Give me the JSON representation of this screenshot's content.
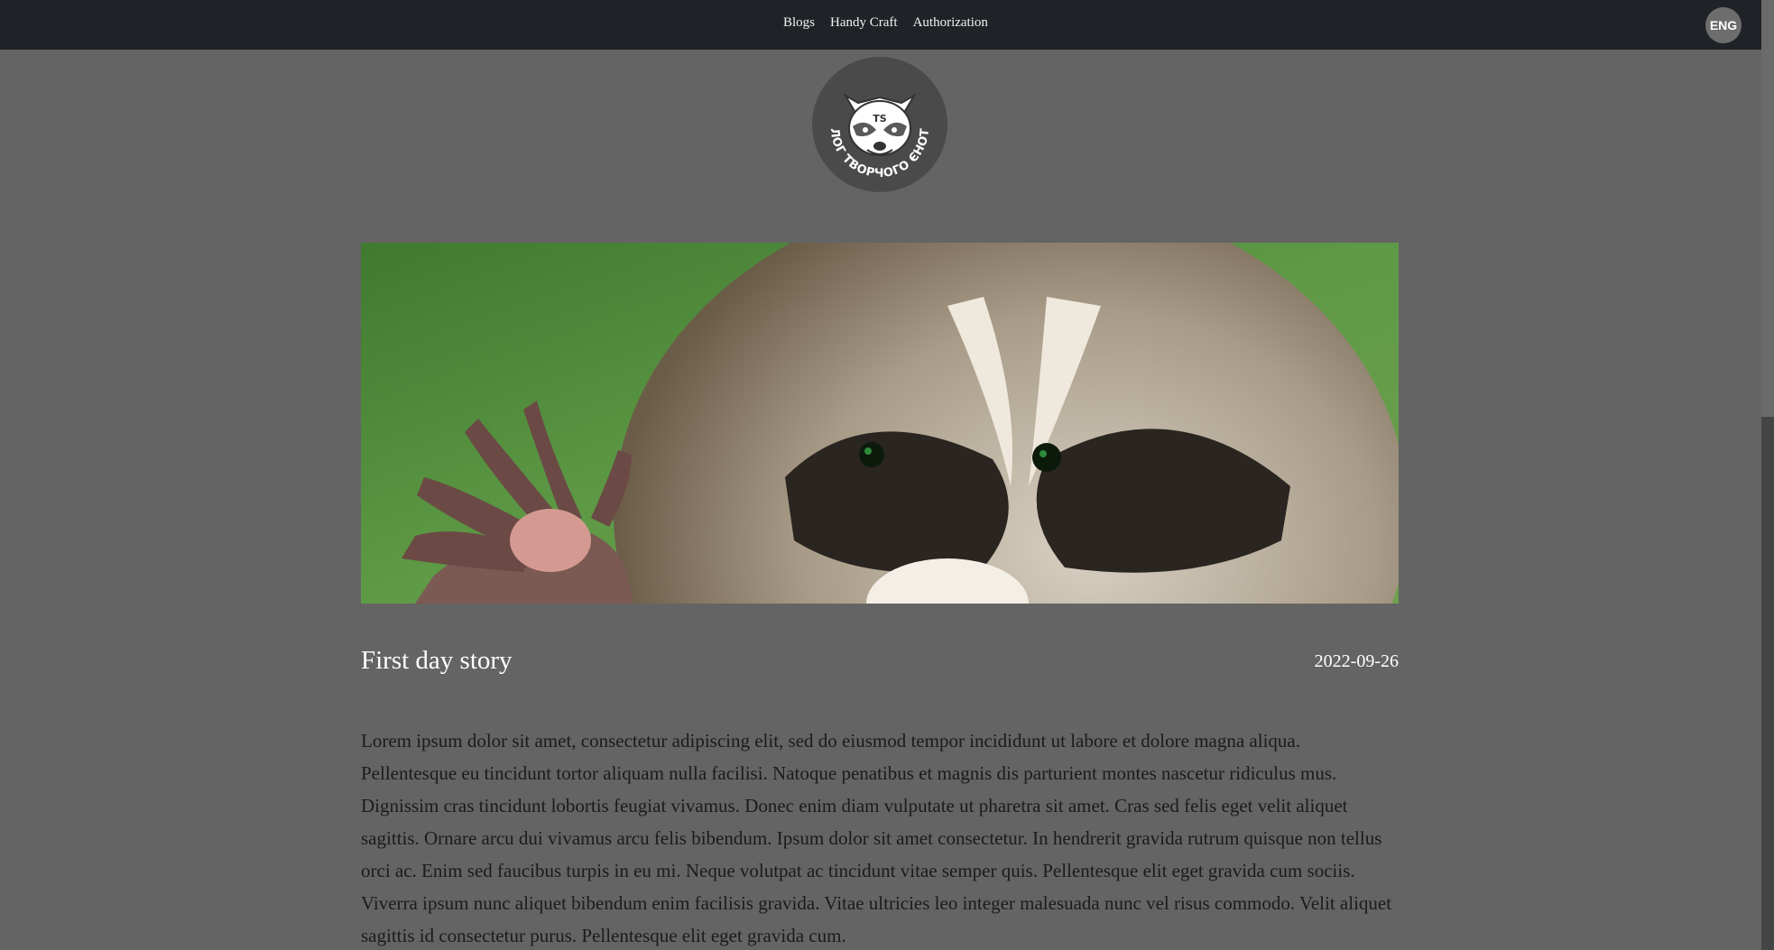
{
  "nav": {
    "links": [
      "Blogs",
      "Handy Craft",
      "Authorization"
    ],
    "language": "ENG"
  },
  "logo": {
    "initials": "TS",
    "caption": "\"БЛОГ ТВОРЧОГО ЄНОТА\""
  },
  "post": {
    "title": "First day story",
    "date": "2022-09-26",
    "body": "Lorem ipsum dolor sit amet, consectetur adipiscing elit, sed do eiusmod tempor incididunt ut labore et dolore magna aliqua. Pellentesque eu tincidunt tortor aliquam nulla facilisi. Natoque penatibus et magnis dis parturient montes nascetur ridiculus mus. Dignissim cras tincidunt lobortis feugiat vivamus. Donec enim diam vulputate ut pharetra sit amet. Cras sed felis eget velit aliquet sagittis. Ornare arcu dui vivamus arcu felis bibendum. Ipsum dolor sit amet consectetur. In hendrerit gravida rutrum quisque non tellus orci ac. Enim sed faucibus turpis in eu mi. Neque volutpat ac tincidunt vitae semper quis. Pellentesque elit eget gravida cum sociis. Viverra ipsum nunc aliquet bibendum enim facilisis gravida. Vitae ultricies leo integer malesuada nunc vel risus commodo. Velit aliquet sagittis id consectetur purus. Pellentesque elit eget gravida cum."
  },
  "colors": {
    "navbar": "#1f2227",
    "page": "#646464",
    "logo_bg": "#4a4a4a"
  }
}
